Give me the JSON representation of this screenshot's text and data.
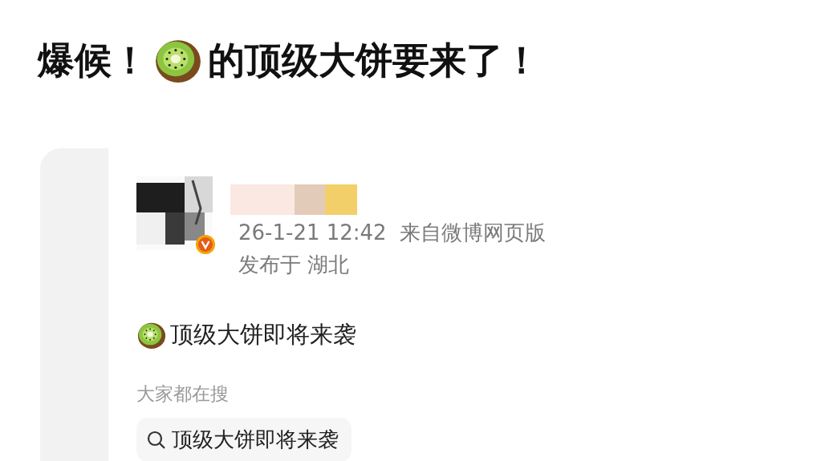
{
  "headline": {
    "before": "爆候！",
    "after": "的顶级大饼要来了！"
  },
  "post": {
    "verified": true,
    "timestamp": "26-1-21 12:42",
    "source": "来自微博网页版",
    "location_label": "发布于",
    "location": "湖北",
    "text": "顶级大饼即将来袭"
  },
  "trending": {
    "heading": "大家都在搜",
    "chips": [
      {
        "text": "顶级大饼即将来袭"
      }
    ]
  }
}
